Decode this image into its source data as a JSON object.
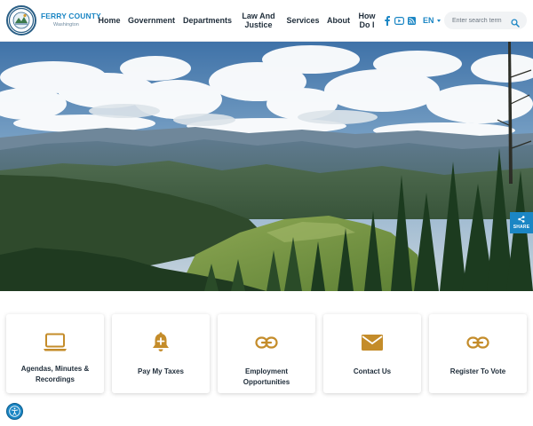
{
  "brand": {
    "name": "FERRY COUNTY",
    "subtitle": "Washington",
    "logo_icon": "county-seal-icon",
    "accent": "#1b86c4"
  },
  "nav": {
    "home": "Home",
    "government": "Government",
    "departments": "Departments",
    "law_and_justice": "Law And Justice",
    "services": "Services",
    "about": "About",
    "how_do_i": "How Do I"
  },
  "social": {
    "facebook_icon": "facebook-icon",
    "youtube_icon": "youtube-icon",
    "rss_icon": "rss-icon"
  },
  "language": {
    "selected": "EN"
  },
  "search": {
    "placeholder": "Enter search term",
    "value": ""
  },
  "hero": {
    "image": "mountain-forest-landscape",
    "share_label": "SHARE"
  },
  "quick_links": [
    {
      "label": "Agendas, Minutes & Recordings",
      "icon": "laptop-icon"
    },
    {
      "label": "Pay My Taxes",
      "icon": "bell-plus-icon"
    },
    {
      "label": "Employment Opportunities",
      "icon": "link-icon"
    },
    {
      "label": "Contact Us",
      "icon": "envelope-icon"
    },
    {
      "label": "Register To Vote",
      "icon": "link-icon"
    }
  ],
  "accessibility": {
    "icon": "accessibility-icon"
  }
}
